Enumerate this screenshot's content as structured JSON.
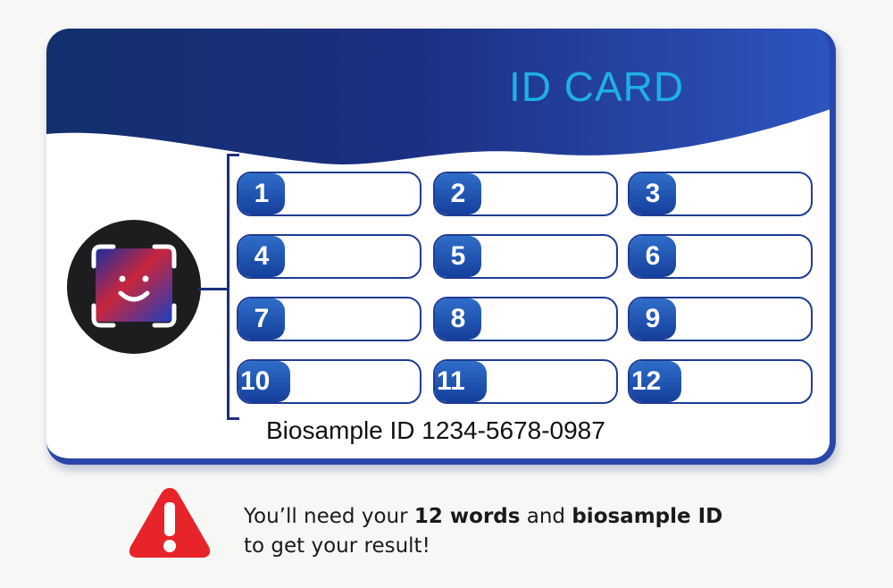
{
  "card": {
    "title": "ID CARD",
    "colors": {
      "header_dark": "#132f6d",
      "header_light": "#2b50b8",
      "title": "#1fb0e6",
      "field_border": "#1f3c93"
    },
    "fields": [
      "1",
      "2",
      "3",
      "4",
      "5",
      "6",
      "7",
      "8",
      "9",
      "10",
      "11",
      "12"
    ],
    "biosample_label": "Biosample ID",
    "biosample_id": "1234-5678-0987",
    "face_icon": "face-id-icon"
  },
  "notice": {
    "icon": "warning-icon",
    "line1_prefix": "You’ll need your ",
    "line1_bold1": "12 words",
    "line1_mid": " and ",
    "line1_bold2": "biosample ID",
    "line2": "to get your result!",
    "icon_color": "#e8242b"
  }
}
